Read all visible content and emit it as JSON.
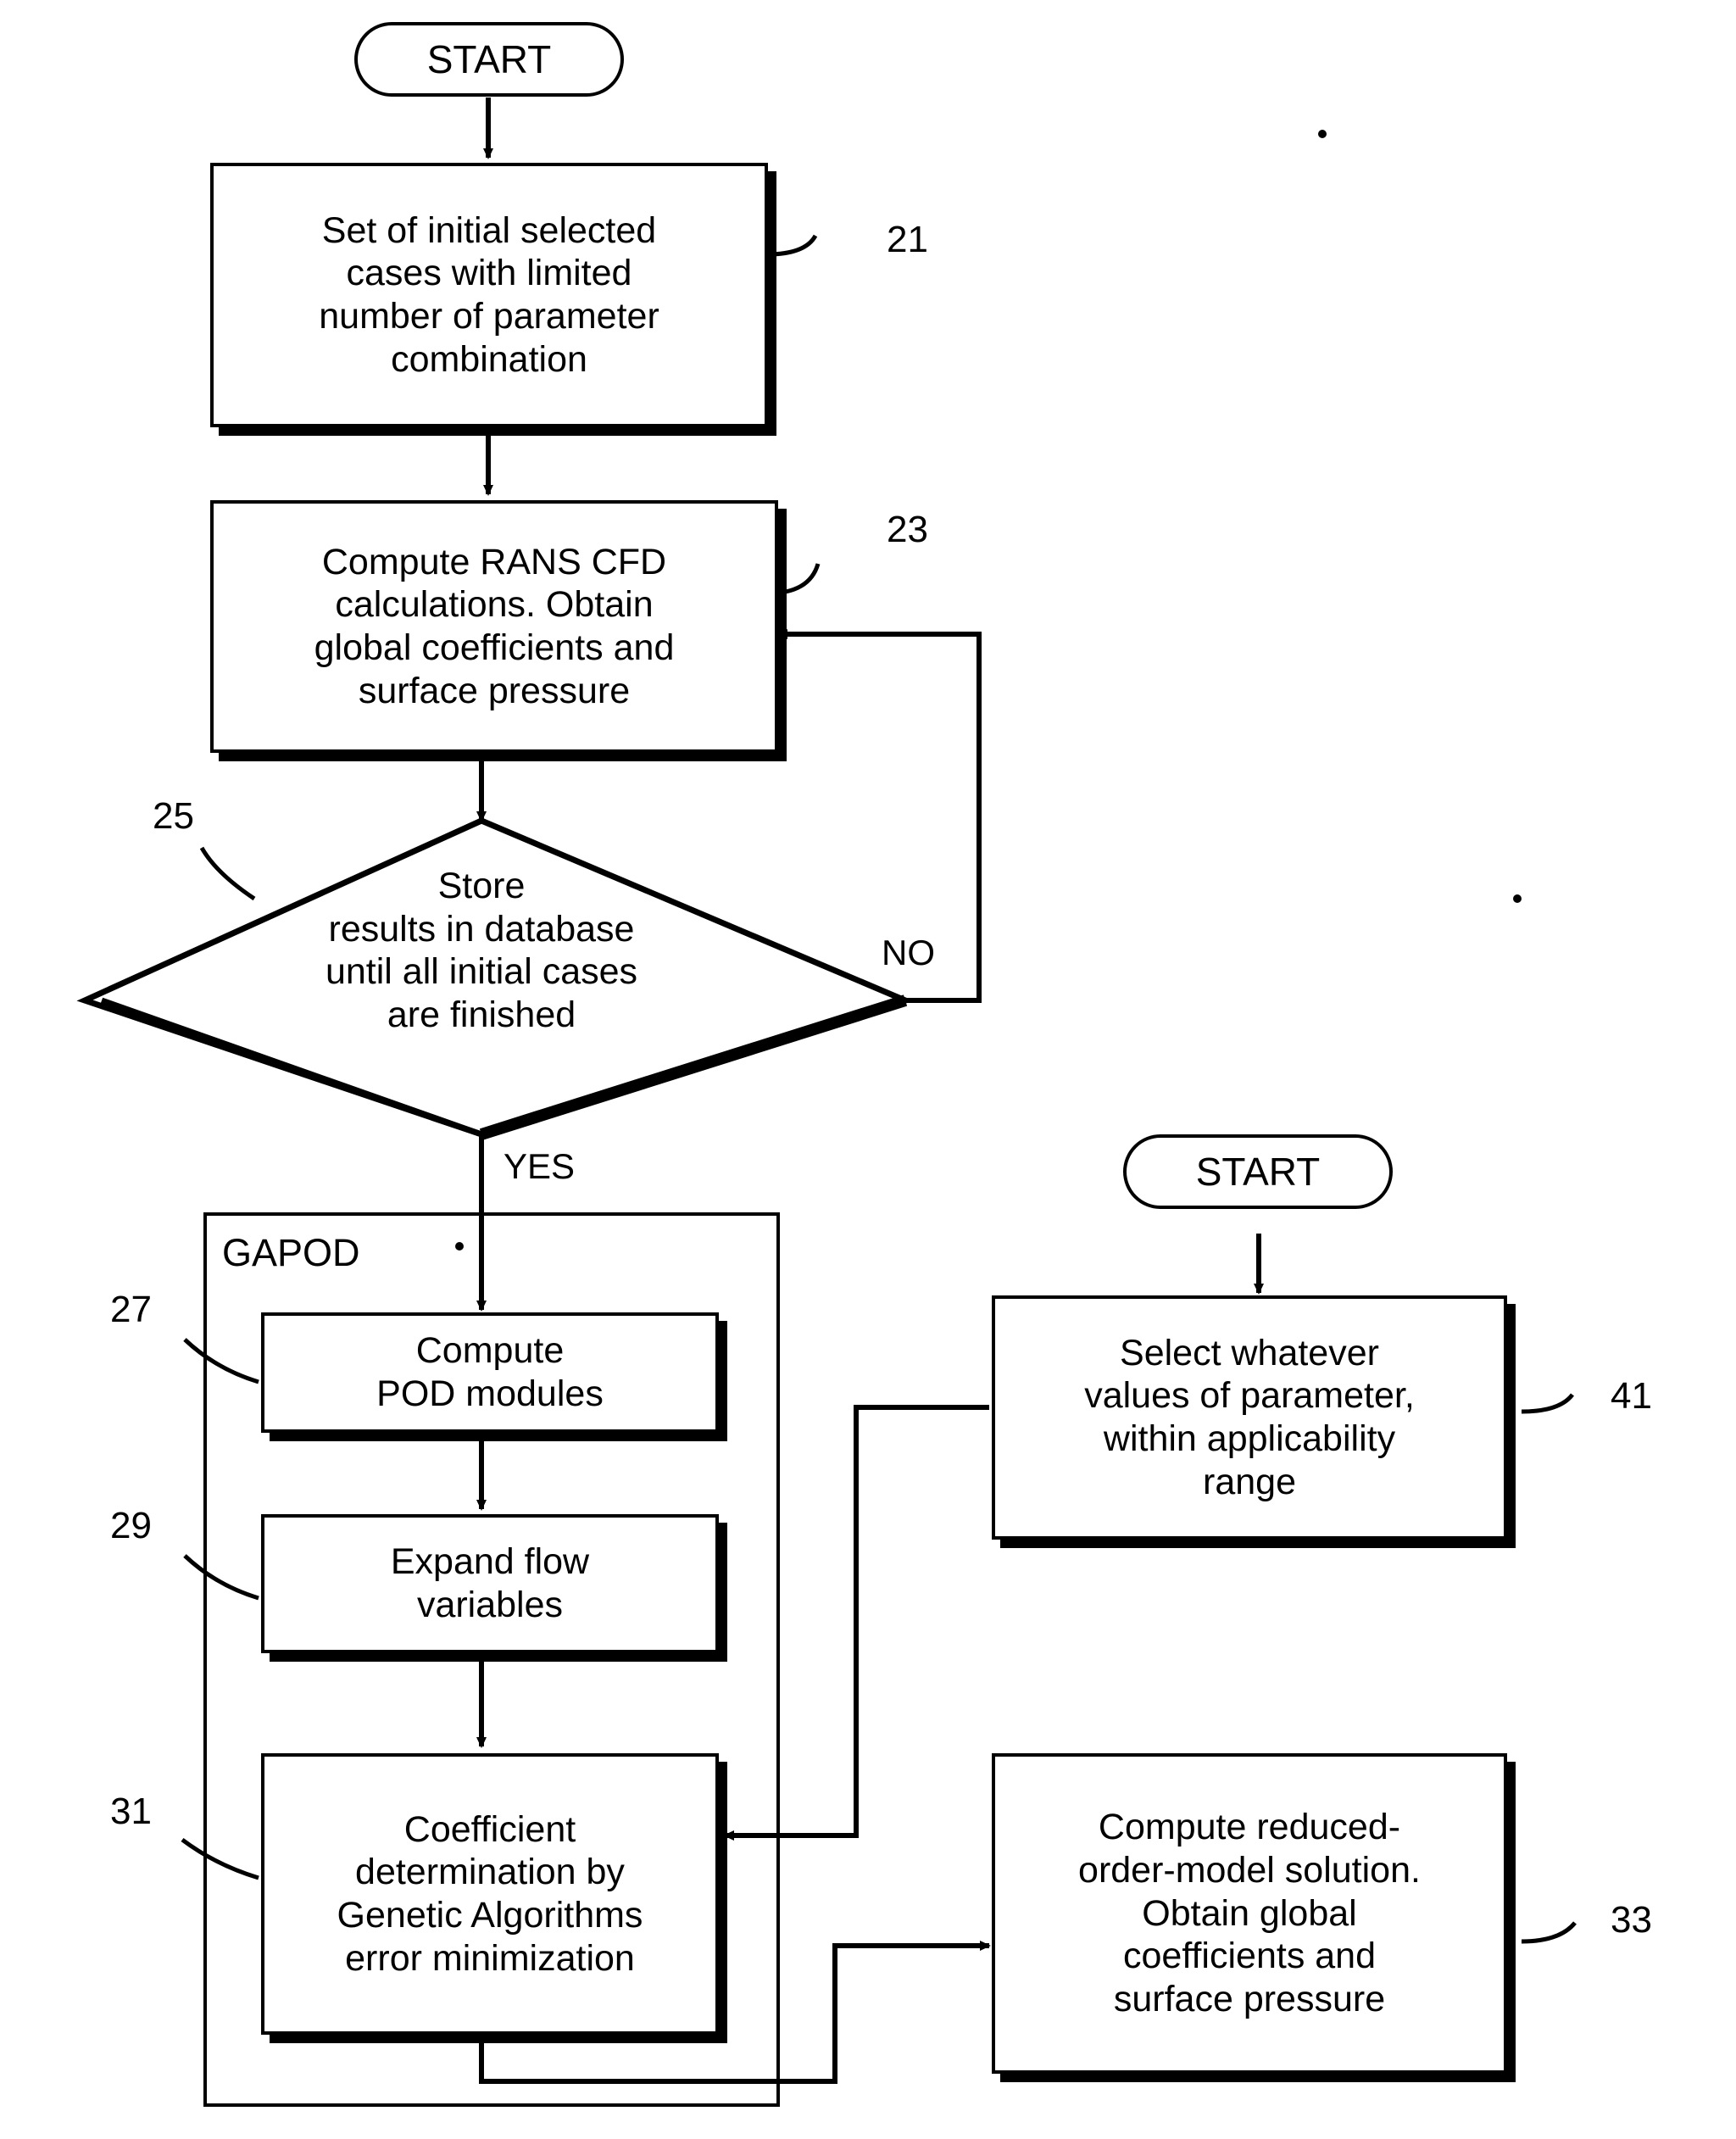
{
  "diagram": {
    "type": "flowchart",
    "title": "",
    "nodes": [
      {
        "id": "start_left",
        "label": "START",
        "shape": "terminal"
      },
      {
        "id": "n21",
        "label": "Set of initial selected\ncases with limited\nnumber of parameter\ncombination",
        "shape": "process",
        "ref": "21"
      },
      {
        "id": "n23",
        "label": "Compute RANS CFD\ncalculations. Obtain\nglobal coefficients and\nsurface pressure",
        "shape": "process",
        "ref": "23"
      },
      {
        "id": "n25",
        "label": "Store\nresults in database\nuntil all initial cases\nare finished",
        "shape": "decision",
        "ref": "25"
      },
      {
        "id": "n27",
        "label": "Compute\nPOD modules",
        "shape": "process",
        "ref": "27"
      },
      {
        "id": "n29",
        "label": "Expand flow\nvariables",
        "shape": "process",
        "ref": "29"
      },
      {
        "id": "n31",
        "label": "Coefficient\ndetermination by\nGenetic Algorithms\nerror minimization",
        "shape": "process",
        "ref": "31"
      },
      {
        "id": "start_right",
        "label": "START",
        "shape": "terminal"
      },
      {
        "id": "n41",
        "label": "Select whatever\nvalues of parameter,\nwithin applicability\nrange",
        "shape": "process",
        "ref": "41"
      },
      {
        "id": "n33",
        "label": "Compute reduced-\norder-model solution.\nObtain global\ncoefficients and\nsurface pressure",
        "shape": "process",
        "ref": "33"
      }
    ],
    "group": {
      "id": "gapod",
      "label": "GAPOD",
      "contains": [
        "n27",
        "n29",
        "n31"
      ]
    },
    "edge_labels": [
      {
        "id": "no",
        "text": "NO"
      },
      {
        "id": "yes",
        "text": "YES"
      }
    ],
    "reference_numbers": [
      "21",
      "23",
      "25",
      "27",
      "29",
      "31",
      "33",
      "41"
    ]
  }
}
